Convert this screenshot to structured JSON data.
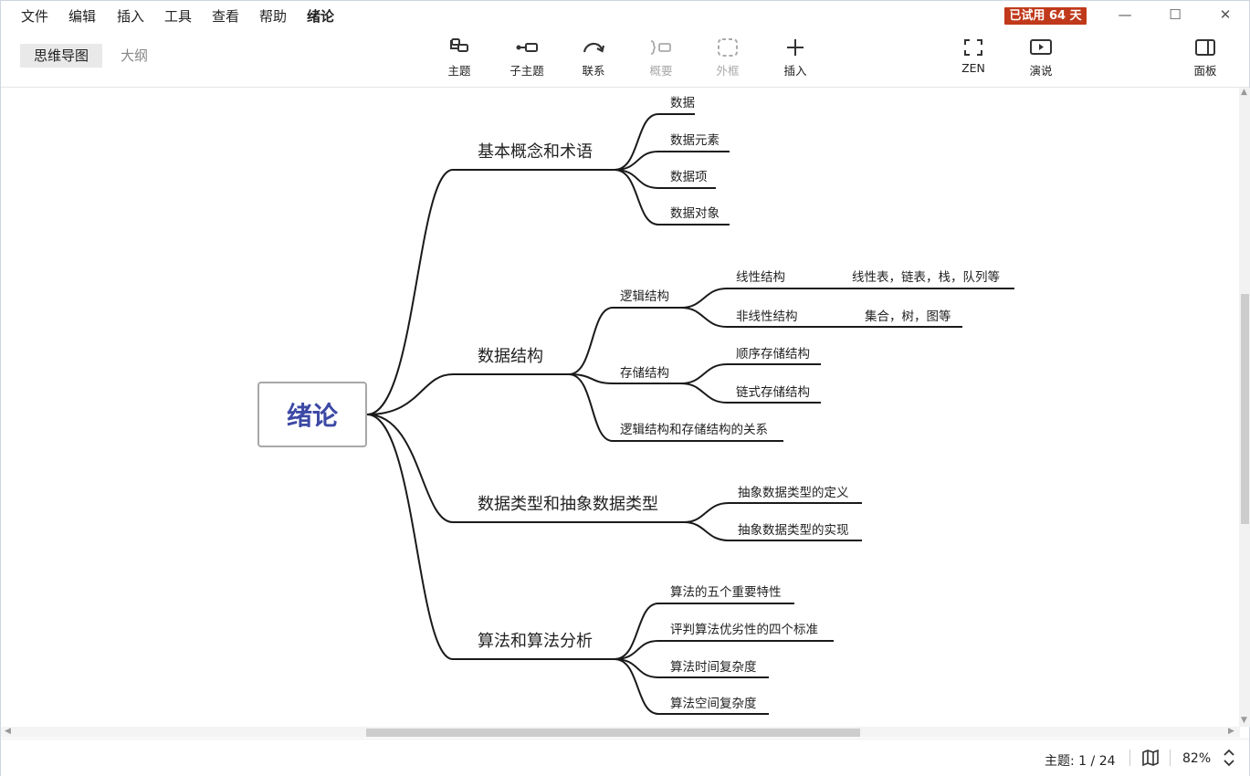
{
  "menu": {
    "items": [
      "文件",
      "编辑",
      "插入",
      "工具",
      "查看",
      "帮助"
    ],
    "doc_title": "绪论",
    "trial_badge": "已试用 64 天"
  },
  "toolbar": {
    "view_tabs": {
      "mindmap": "思维导图",
      "outline": "大纲"
    },
    "topic": "主题",
    "subtopic": "子主题",
    "relationship": "联系",
    "summary": "概要",
    "boundary": "外框",
    "insert": "插入",
    "zen": "ZEN",
    "present": "演说",
    "panel": "面板"
  },
  "mindmap": {
    "central": "绪论",
    "b1": {
      "label": "基本概念和术语",
      "c1": "数据",
      "c2": "数据元素",
      "c3": "数据项",
      "c4": "数据对象"
    },
    "b2": {
      "label": "数据结构",
      "logical": {
        "label": "逻辑结构",
        "linear": {
          "label": "线性结构",
          "detail": "线性表，链表，栈，队列等"
        },
        "nonlinear": {
          "label": "非线性结构",
          "detail": "集合，树，图等"
        }
      },
      "storage": {
        "label": "存储结构",
        "seq": "顺序存储结构",
        "linked": "链式存储结构"
      },
      "relation": "逻辑结构和存储结构的关系"
    },
    "b3": {
      "label": "数据类型和抽象数据类型",
      "c1": "抽象数据类型的定义",
      "c2": "抽象数据类型的实现"
    },
    "b4": {
      "label": "算法和算法分析",
      "c1": "算法的五个重要特性",
      "c2": "评判算法优劣性的四个标准",
      "c3": "算法时间复杂度",
      "c4": "算法空间复杂度"
    }
  },
  "status": {
    "topic_count": "主题: 1 / 24",
    "zoom": "82%"
  }
}
